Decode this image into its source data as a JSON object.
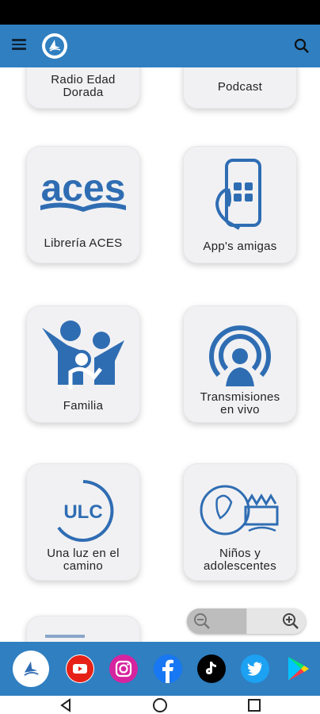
{
  "app": {
    "title": "",
    "menu_icon": "menu-icon",
    "logo_icon": "adventist-logo-icon",
    "search_icon": "search-icon"
  },
  "tiles": [
    {
      "label_lines": [
        "Radio Edad",
        "Dorada"
      ],
      "icon": "radio-icon"
    },
    {
      "label_lines": [
        "Podcast"
      ],
      "icon": "podcast-icon"
    },
    {
      "label_lines": [
        "Librería ACES"
      ],
      "icon": "aces-book-icon"
    },
    {
      "label_lines": [
        "App's amigas"
      ],
      "icon": "phone-apps-icon"
    },
    {
      "label_lines": [
        "Familia"
      ],
      "icon": "family-icon"
    },
    {
      "label_lines": [
        "Transmisiones",
        "en vivo"
      ],
      "icon": "live-broadcast-icon"
    },
    {
      "label_lines": [
        "Una luz en el",
        "camino"
      ],
      "icon": "ulc-icon",
      "icon_text": "ULC"
    },
    {
      "label_lines": [
        "Niños y",
        "adolescentes"
      ],
      "icon": "kids-icon"
    }
  ],
  "aces_logo_text": "aces",
  "zoom": {
    "out_icon": "zoom-out-icon",
    "in_icon": "zoom-in-icon"
  },
  "social": [
    {
      "name": "adventist-logo-icon"
    },
    {
      "name": "youtube-icon",
      "color": "#e62117"
    },
    {
      "name": "instagram-icon",
      "color": "#d6249f"
    },
    {
      "name": "facebook-icon",
      "color": "#1877f2"
    },
    {
      "name": "tiktok-icon",
      "color": "#000000"
    },
    {
      "name": "twitter-icon",
      "color": "#1da1f2"
    },
    {
      "name": "google-play-icon"
    }
  ],
  "colors": {
    "accent": "#2f7fc1",
    "icon_blue": "#2f6db3"
  }
}
